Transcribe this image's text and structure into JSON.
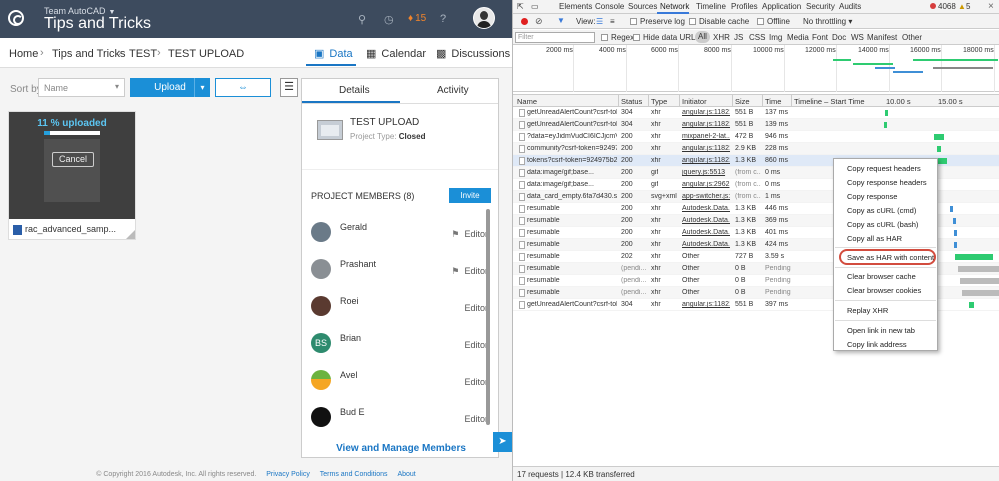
{
  "app": {
    "team": "Team AutoCAD",
    "title": "Tips and Tricks",
    "notif_count": "15",
    "breadcrumbs": [
      "Home",
      "Tips and Tricks",
      "TEST",
      "TEST UPLOAD"
    ],
    "tabs": [
      "Data",
      "Calendar",
      "Discussions"
    ],
    "sort_label": "Sort by",
    "sort_value": "Name",
    "upload_label": "Upload",
    "file": {
      "progress_text": "11 % uploaded",
      "progress": 11,
      "cancel": "Cancel",
      "name": "rac_advanced_samp..."
    },
    "panel": {
      "tabs": [
        "Details",
        "Activity"
      ],
      "project_title": "TEST UPLOAD",
      "project_type_label": "Project Type:",
      "project_type": "Closed",
      "members_header": "PROJECT MEMBERS (8)",
      "invite": "Invite",
      "members": [
        {
          "name": "Gerald",
          "role": "Editor",
          "initials": ""
        },
        {
          "name": "Prashant",
          "role": "Editor",
          "initials": ""
        },
        {
          "name": "Roei",
          "role": "Editor",
          "initials": ""
        },
        {
          "name": "Brian",
          "role": "Editor",
          "initials": "BS"
        },
        {
          "name": "Avel",
          "role": "Editor",
          "initials": ""
        },
        {
          "name": "Bud E",
          "role": "Editor",
          "initials": ""
        }
      ],
      "view_manage": "View and Manage Members"
    },
    "footer": {
      "copyright": "© Copyright 2016 Autodesk, Inc. All rights reserved.",
      "links": [
        "Privacy Policy",
        "Terms and Conditions",
        "About"
      ]
    }
  },
  "devtools": {
    "tabs": [
      "Elements",
      "Console",
      "Sources",
      "Network",
      "Timeline",
      "Profiles",
      "Application",
      "Security",
      "Audits"
    ],
    "error_count": "4068",
    "warn_count": "5",
    "toolbar": {
      "view": "View:",
      "preserve_log": "Preserve log",
      "disable_cache": "Disable cache",
      "offline": "Offline",
      "throttle": "No throttling"
    },
    "filter": {
      "placeholder": "Filter",
      "regex": "Regex",
      "hide_data": "Hide data URLs",
      "types": [
        "All",
        "XHR",
        "JS",
        "CSS",
        "Img",
        "Media",
        "Font",
        "Doc",
        "WS",
        "Manifest",
        "Other"
      ]
    },
    "overview_ticks": [
      "2000 ms",
      "4000 ms",
      "6000 ms",
      "8000 ms",
      "10000 ms",
      "12000 ms",
      "14000 ms",
      "16000 ms",
      "18000 ms"
    ],
    "columns": [
      "Name",
      "Status",
      "Type",
      "Initiator",
      "Size",
      "Time",
      "Timeline – Start Time",
      "10.00 s",
      "15.00 s"
    ],
    "requests": [
      {
        "name": "getUnreadAlertCount?csrf-tok...",
        "status": "304",
        "type": "xhr",
        "initiator": "angular.js:11821",
        "size": "551 B",
        "time": "137 ms"
      },
      {
        "name": "getUnreadAlertCount?csrf-tok...",
        "status": "304",
        "type": "xhr",
        "initiator": "angular.js:11821",
        "size": "551 B",
        "time": "139 ms"
      },
      {
        "name": "?data=eyJidmVudCI6ICJjcmVh...",
        "status": "200",
        "type": "xhr",
        "initiator": "mixpanel-2-lat...",
        "size": "472 B",
        "time": "946 ms"
      },
      {
        "name": "community?csrf-token=92497...",
        "status": "200",
        "type": "xhr",
        "initiator": "angular.js:11821",
        "size": "2.9 KB",
        "time": "228 ms"
      },
      {
        "name": "tokens?csrf-token=924975b2...",
        "status": "200",
        "type": "xhr",
        "initiator": "angular.js:11821",
        "size": "1.3 KB",
        "time": "860 ms"
      },
      {
        "name": "data:image/gif;base...",
        "status": "200",
        "type": "gif",
        "initiator": "jquery.js:5513",
        "size": "(from c...",
        "time": "0 ms"
      },
      {
        "name": "data:image/gif;base...",
        "status": "200",
        "type": "gif",
        "initiator": "angular.js:2962",
        "size": "(from c...",
        "time": "0 ms"
      },
      {
        "name": "data_card_empty.6fa7d430.svg",
        "status": "200",
        "type": "svg+xml",
        "initiator": "app-switcher.js:1",
        "size": "(from c...",
        "time": "1 ms"
      },
      {
        "name": "resumable",
        "status": "200",
        "type": "xhr",
        "initiator": "Autodesk.Data...",
        "size": "1.3 KB",
        "time": "446 ms"
      },
      {
        "name": "resumable",
        "status": "200",
        "type": "xhr",
        "initiator": "Autodesk.Data...",
        "size": "1.3 KB",
        "time": "369 ms"
      },
      {
        "name": "resumable",
        "status": "200",
        "type": "xhr",
        "initiator": "Autodesk.Data...",
        "size": "1.3 KB",
        "time": "401 ms"
      },
      {
        "name": "resumable",
        "status": "200",
        "type": "xhr",
        "initiator": "Autodesk.Data...",
        "size": "1.3 KB",
        "time": "424 ms"
      },
      {
        "name": "resumable",
        "status": "202",
        "type": "xhr",
        "initiator": "Other",
        "size": "727 B",
        "time": "3.59 s"
      },
      {
        "name": "resumable",
        "status": "(pendi...",
        "type": "xhr",
        "initiator": "Other",
        "size": "0 B",
        "time": "Pending"
      },
      {
        "name": "resumable",
        "status": "(pendi...",
        "type": "xhr",
        "initiator": "Other",
        "size": "0 B",
        "time": "Pending"
      },
      {
        "name": "resumable",
        "status": "(pendi...",
        "type": "xhr",
        "initiator": "Other",
        "size": "0 B",
        "time": "Pending"
      },
      {
        "name": "getUnreadAlertCount?csrf-tok...",
        "status": "304",
        "type": "xhr",
        "initiator": "angular.js:11821",
        "size": "551 B",
        "time": "397 ms"
      }
    ],
    "context_menu": [
      "Copy request headers",
      "Copy response headers",
      "Copy response",
      "Copy as cURL (cmd)",
      "Copy as cURL (bash)",
      "Copy all as HAR",
      "Save as HAR with content",
      "Clear browser cache",
      "Clear browser cookies",
      "Replay XHR",
      "Open link in new tab",
      "Copy link address"
    ],
    "status": "17 requests  |  12.4 KB transferred"
  },
  "colors": {
    "accent": "#1b8fd7",
    "topbar": "#3d4b5e",
    "highlight_ring": "#d24c3e",
    "bar_green": "#2ecb71",
    "bar_blue": "#3f8fd6"
  }
}
